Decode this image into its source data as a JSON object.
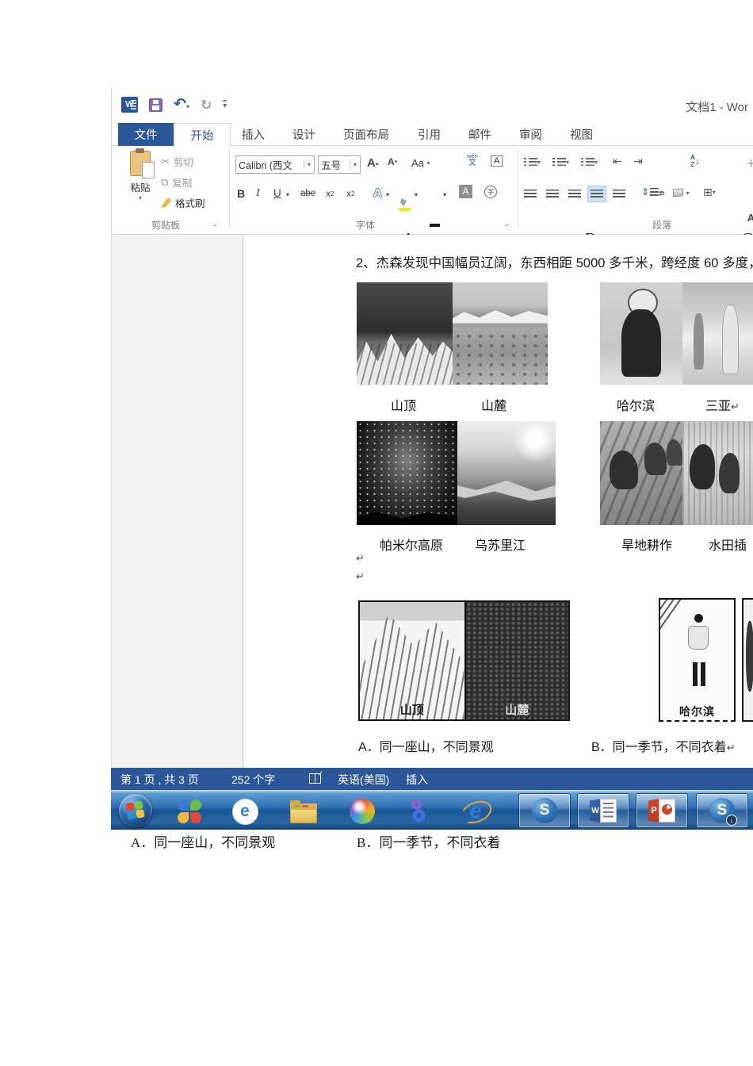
{
  "icons": {
    "dd": "▾",
    "tu": "▴",
    "undo": "↶",
    "redo": "↻",
    "launcher": "⌟",
    "pilcrow": "↵",
    "scissors": "✂",
    "copy": "⧉",
    "borders": "⊞",
    "sort_arrow": "↓",
    "updown": "⇕",
    "indent_l": "⇤",
    "indent_r": "⇥",
    "partial": "＋",
    "ie_e": "e",
    "browser_e": "e"
  },
  "window": {
    "title": "文档1 - Wor"
  },
  "tabs": [
    {
      "label": "文件"
    },
    {
      "label": "开始"
    },
    {
      "label": "插入"
    },
    {
      "label": "设计"
    },
    {
      "label": "页面布局"
    },
    {
      "label": "引用"
    },
    {
      "label": "邮件"
    },
    {
      "label": "审阅"
    },
    {
      "label": "视图"
    }
  ],
  "ribbon": {
    "clipboard": {
      "group": "剪贴板",
      "paste": "粘贴",
      "cut": "剪切",
      "copy": "复制",
      "format_painter": "格式刷"
    },
    "font": {
      "group": "字体",
      "name": "Calibri (西文",
      "size": "五号",
      "grow": "A",
      "shrink": "A",
      "case": "Aa",
      "clear": "A",
      "wen_top": "wén",
      "wen_bottom": "文",
      "char_border": "A",
      "bold": "B",
      "italic": "I",
      "underline": "U",
      "strike": "abe",
      "sub_base": "x",
      "sub_script": "2",
      "sup_base": "x",
      "sup_script": "2",
      "effects": "A",
      "color": "A",
      "shading": "A",
      "enclose": "字"
    },
    "paragraph": {
      "group": "段落",
      "sort_a": "A",
      "sort_z": "Z",
      "cn_a": "A"
    }
  },
  "document": {
    "top_letters": {
      "a": "A",
      "b": "B",
      "c": "C"
    },
    "question": "2、杰森发现中国幅员辽阔，东西相距 5000 多千米，跨经度 60 多度，",
    "captions_row1": {
      "c1": "山顶",
      "c2": "山麓",
      "c3": "哈尔滨",
      "c4": "三亚"
    },
    "captions_row2": {
      "c1": "帕米尔高原",
      "c2": "乌苏里江",
      "c3": "旱地耕作",
      "c4": "水田插"
    },
    "box_a": {
      "left_label": "山顶",
      "right_label": "山麓"
    },
    "box_b": {
      "label": "哈尔滨"
    },
    "option_a": "A．同一座山，不同景观",
    "option_b": "B．同一季节，不同衣着"
  },
  "status_bar": {
    "page_info": "第 1 页 , 共 3 页",
    "word_count": "252 个字",
    "language": "英语(美国)",
    "insert_mode": "插入"
  },
  "taskbar_icons": {
    "sogou_s": "S",
    "sogou_dl_s": "S",
    "word_w": "W",
    "ppt_p": "P",
    "dl_arrow": "↓"
  },
  "footer": {
    "option_a": "A．同一座山，不同景观",
    "option_b": "B．同一季节，不同衣着"
  }
}
